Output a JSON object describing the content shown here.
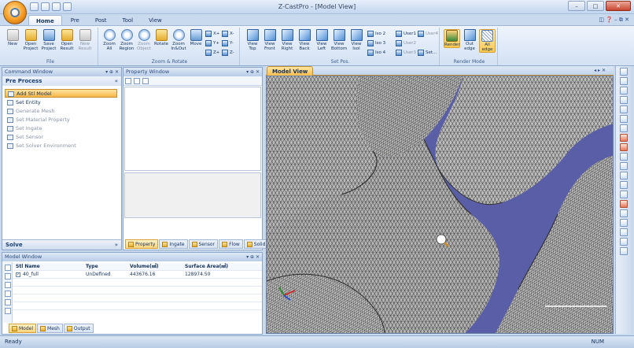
{
  "app": {
    "title": "Z-CastPro - [Model View]"
  },
  "window_controls": {
    "minimize": "–",
    "maximize": "□",
    "close": "✕"
  },
  "tabs": [
    "Home",
    "Pre",
    "Post",
    "Tool",
    "View"
  ],
  "help_icons": "◫ ❓ – ⧉ ✕",
  "ribbon": {
    "file": {
      "name": "File",
      "buttons": [
        "New",
        "Open Project",
        "Save Project",
        "Open Result",
        "New Result"
      ]
    },
    "zoom": {
      "name": "Zoom & Rotate",
      "buttons": [
        "Zoom All",
        "Zoom Region",
        "Zoom Object",
        "Rotate",
        "Zoom In&Out",
        "Move"
      ],
      "axes": [
        "X+",
        "X-",
        "Y+",
        "Y-",
        "Z+",
        "Z-"
      ]
    },
    "setpos": {
      "name": "Set Pos.",
      "buttons": [
        "View Top",
        "View Front",
        "View Right",
        "View Back",
        "View Left",
        "View Bottom",
        "View Isol"
      ],
      "iso": [
        "Iso 2",
        "Iso 3",
        "Iso 4"
      ],
      "user": [
        "User1",
        "User2",
        "User3",
        "User4",
        "Set..."
      ]
    },
    "render": {
      "name": "Render Mode",
      "buttons": [
        "Render",
        "Out edge",
        "All edge"
      ]
    }
  },
  "command_window": {
    "title": "Command Window",
    "section": "Pre Process",
    "items": [
      {
        "label": "Add Stl Model",
        "selected": true
      },
      {
        "label": "Set Entity"
      },
      {
        "label": "Generate Mesh"
      },
      {
        "label": "Set Material Property"
      },
      {
        "label": "Set Ingate"
      },
      {
        "label": "Set Sensor"
      },
      {
        "label": "Set Solver Environment"
      }
    ],
    "footer": "Solve"
  },
  "property_window": {
    "title": "Property Window",
    "tabs": [
      "Property",
      "Ingate",
      "Sensor",
      "Flow",
      "Solid"
    ]
  },
  "model_window": {
    "title": "Model Window",
    "columns": [
      "Stl Name",
      "Type",
      "Volume(㎣)",
      "Surface Area(㎟)"
    ],
    "rows": [
      {
        "name": "40_full",
        "type": "UnDefined",
        "volume": "443676.16",
        "area": "128974.50"
      }
    ],
    "tabs": [
      "Model",
      "Mesh",
      "Output"
    ]
  },
  "model_view": {
    "tab": "Model View",
    "background": "#595ea6",
    "mesh_fill": "#b9b9b9"
  },
  "status": {
    "left": "Ready",
    "right": "NUM"
  },
  "colors": {
    "accent": "#f8bd4f",
    "chrome": "#c9d9ee"
  }
}
